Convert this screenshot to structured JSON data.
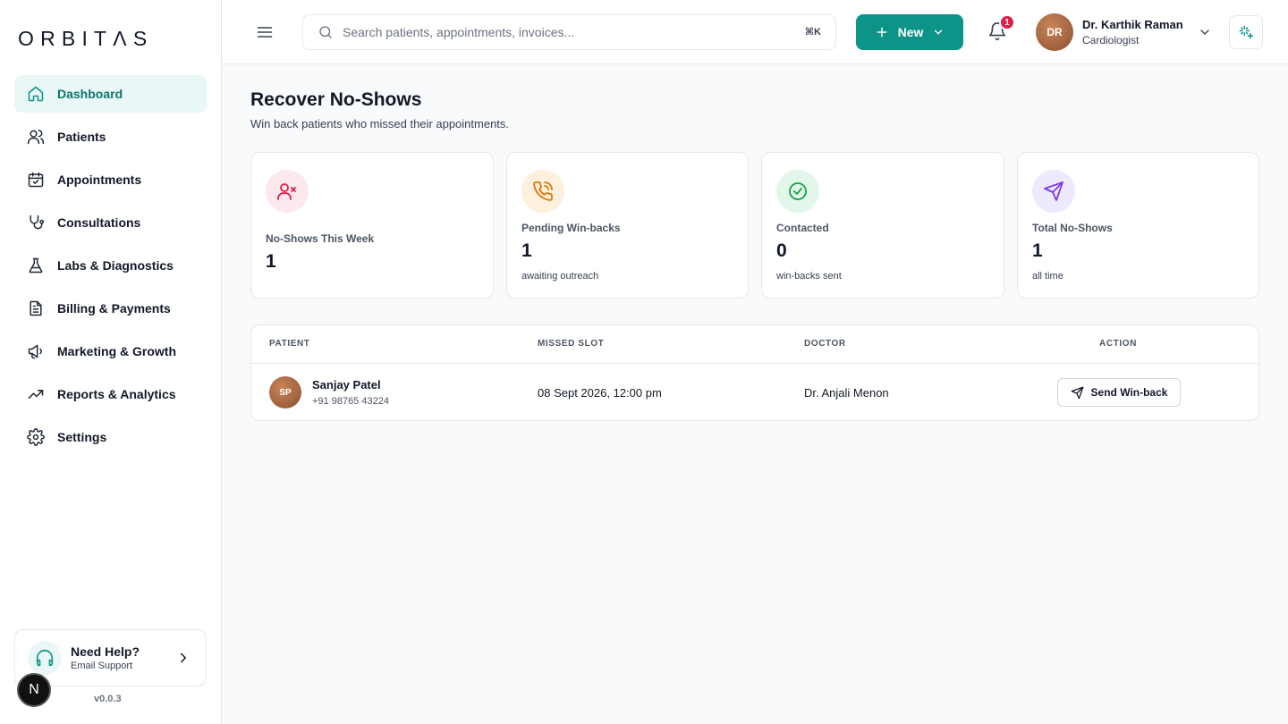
{
  "brand": {
    "logo": "ORBITΛS"
  },
  "sidebar": {
    "items": [
      {
        "label": "Dashboard",
        "icon": "home-icon",
        "active": true
      },
      {
        "label": "Patients",
        "icon": "users-icon"
      },
      {
        "label": "Appointments",
        "icon": "calendar-check-icon"
      },
      {
        "label": "Consultations",
        "icon": "stethoscope-icon"
      },
      {
        "label": "Labs & Diagnostics",
        "icon": "flask-icon"
      },
      {
        "label": "Billing & Payments",
        "icon": "file-text-icon"
      },
      {
        "label": "Marketing & Growth",
        "icon": "megaphone-icon"
      },
      {
        "label": "Reports & Analytics",
        "icon": "trending-up-icon"
      },
      {
        "label": "Settings",
        "icon": "gear-icon"
      }
    ],
    "help": {
      "title": "Need Help?",
      "subtitle": "Email Support"
    },
    "version": "v0.0.3",
    "dev_badge": "N"
  },
  "topbar": {
    "search_placeholder": "Search patients, appointments, invoices...",
    "shortcut": "⌘K",
    "new_label": "New",
    "notification_count": "1",
    "user": {
      "initials": "DR",
      "name": "Dr. Karthik Raman",
      "role": "Cardiologist"
    }
  },
  "page": {
    "title": "Recover No-Shows",
    "subtitle": "Win back patients who missed their appointments."
  },
  "stats": [
    {
      "label": "No-Shows This Week",
      "value": "1",
      "note": "",
      "icon": "user-x-icon",
      "color": "#e11d48",
      "bg": "#fde8ee"
    },
    {
      "label": "Pending Win-backs",
      "value": "1",
      "note": "awaiting outreach",
      "icon": "phone-call-icon",
      "color": "#d97706",
      "bg": "#fdf0dc"
    },
    {
      "label": "Contacted",
      "value": "0",
      "note": "win-backs sent",
      "icon": "check-circle-icon",
      "color": "#16a34a",
      "bg": "#e3f6ea"
    },
    {
      "label": "Total No-Shows",
      "value": "1",
      "note": "all time",
      "icon": "send-icon",
      "color": "#7c3aed",
      "bg": "#efe9fd"
    }
  ],
  "table": {
    "headers": {
      "patient": "PATIENT",
      "missed_slot": "MISSED SLOT",
      "doctor": "DOCTOR",
      "action": "ACTION"
    },
    "rows": [
      {
        "initials": "SP",
        "name": "Sanjay Patel",
        "phone": "+91 98765 43224",
        "missed_slot": "08 Sept 2026, 12:00 pm",
        "doctor": "Dr. Anjali Menon",
        "action": "Send Win-back"
      }
    ]
  },
  "colors": {
    "accent": "#0d9488",
    "badge": "#e11d48"
  }
}
